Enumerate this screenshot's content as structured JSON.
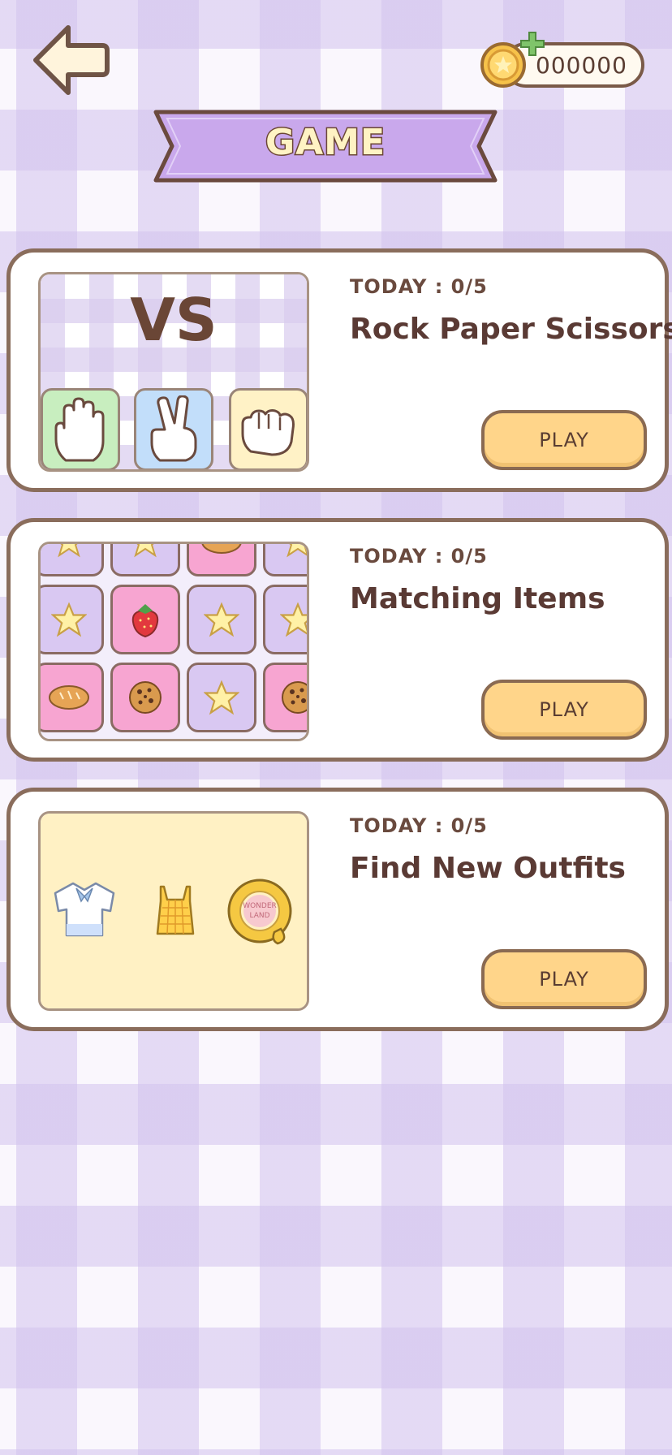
{
  "header": {
    "title": "GAME",
    "coins": "000000"
  },
  "games": [
    {
      "today_label": "TODAY : 0/5",
      "title": "Rock Paper Scissors",
      "play_label": "PLAY",
      "thumb_text": "VS"
    },
    {
      "today_label": "TODAY : 0/5",
      "title": "Matching Items",
      "play_label": "PLAY"
    },
    {
      "today_label": "TODAY : 0/5",
      "title": "Find New Outfits",
      "play_label": "PLAY"
    }
  ],
  "outfit_ring_text": "WONDER LAND",
  "colors": {
    "accent_purple": "#c9a8ec",
    "play_button": "#ffd58a",
    "border_brown": "#8a6d5c",
    "text_brown": "#5a3a34"
  }
}
